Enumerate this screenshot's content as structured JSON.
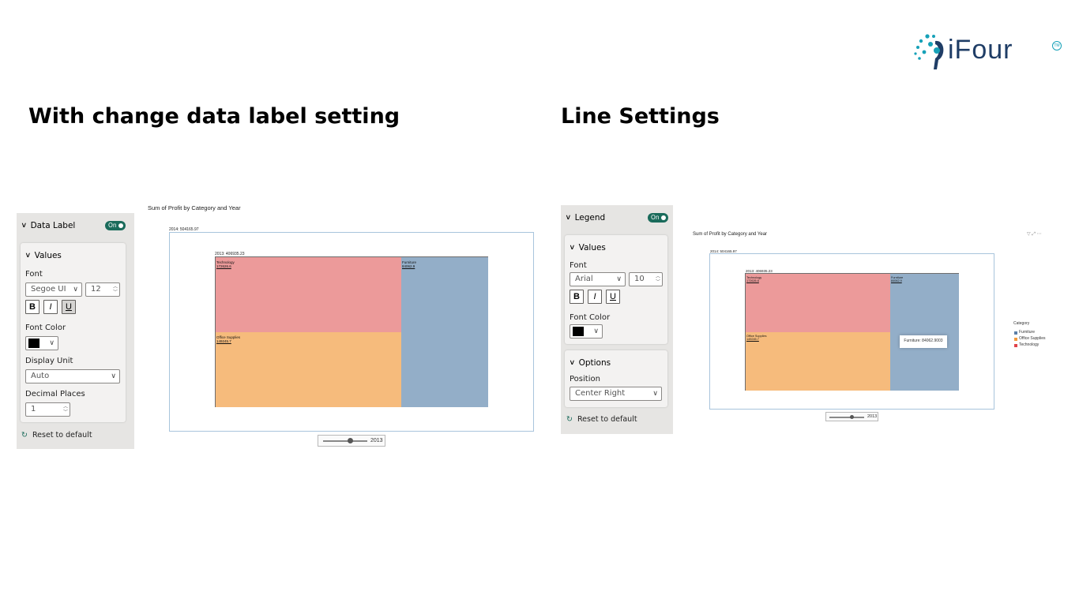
{
  "logo": {
    "text": "iFour",
    "tm": "TM"
  },
  "left": {
    "heading": "With change data label setting",
    "panel": {
      "header": "Data Label",
      "toggle": "On",
      "section": "Values",
      "font_label": "Font",
      "font_value": "Segoe UI",
      "size_value": "12",
      "bold": "B",
      "italic": "I",
      "underline": "U",
      "font_color_label": "Font Color",
      "display_unit_label": "Display Unit",
      "display_unit_value": "Auto",
      "decimal_label": "Decimal Places",
      "decimal_value": "1",
      "reset": "Reset to default"
    },
    "chart": {
      "title": "Sum of Profit by Category and Year",
      "outer_label": "2014: 504165.97",
      "inner_label": "2013: 406935.23",
      "tiles": [
        {
          "name": "Technology",
          "value": "172626.6",
          "color": "#ec9a9a"
        },
        {
          "name": "Office Supplies",
          "value": "149245.7",
          "color": "#f6bb7c"
        },
        {
          "name": "Furniture",
          "value": "84062.9",
          "color": "#93aec8"
        }
      ],
      "slider_value": "2013"
    }
  },
  "right": {
    "heading": "Line Settings",
    "panel": {
      "header": "Legend",
      "toggle": "On",
      "section": "Values",
      "font_label": "Font",
      "font_value": "Arial",
      "size_value": "10",
      "bold": "B",
      "italic": "I",
      "underline": "U",
      "font_color_label": "Font Color",
      "options_section": "Options",
      "position_label": "Position",
      "position_value": "Center Right",
      "reset": "Reset to default"
    },
    "chart": {
      "title": "Sum of Profit by Category and Year",
      "outer_label": "2014: 504165.97",
      "inner_label": "2013: 406935.23",
      "tiles": [
        {
          "name": "Technology",
          "value": "172626.6",
          "color": "#ec9a9a"
        },
        {
          "name": "Office Supplies",
          "value": "149245.7",
          "color": "#f6bb7c"
        },
        {
          "name": "Furniture",
          "value": "84062.9",
          "color": "#93aec8"
        }
      ],
      "tooltip": "Furniture: 84062.9003",
      "slider_value": "2013",
      "legend": {
        "title": "Category",
        "items": [
          {
            "label": "Furniture",
            "color": "#5b7fa8"
          },
          {
            "label": "Office Supplies",
            "color": "#f39a3c"
          },
          {
            "label": "Technology",
            "color": "#e0434a"
          }
        ]
      }
    }
  }
}
